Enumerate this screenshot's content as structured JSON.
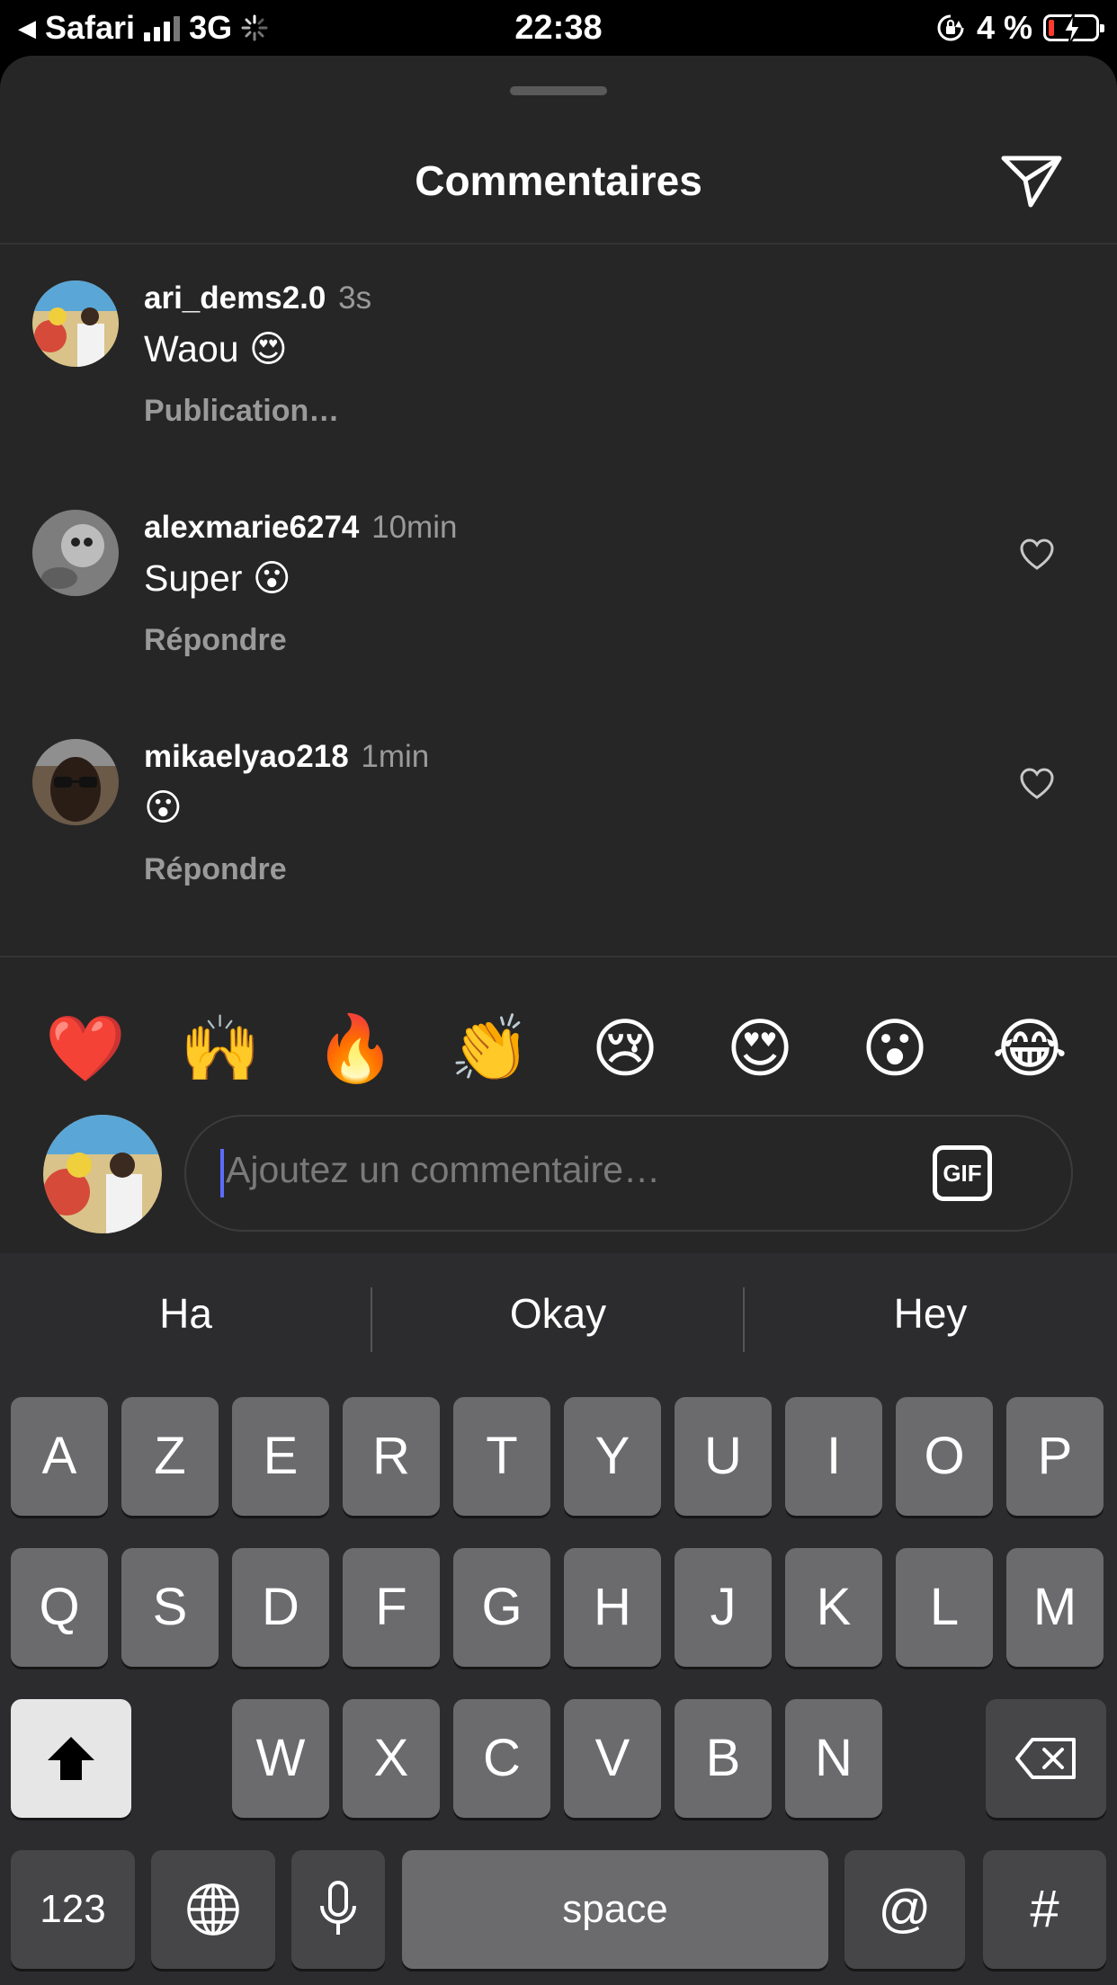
{
  "status_bar": {
    "back_app": "Safari",
    "network": "3G",
    "time": "22:38",
    "battery": "4 %",
    "battery_color": "#ff3b30"
  },
  "sheet": {
    "title": "Commentaires",
    "share_icon": "send-icon"
  },
  "comments": [
    {
      "username": "ari_dems2.0",
      "time": "3s",
      "text": "Waou",
      "emoji": "😍",
      "action": "Publication…"
    },
    {
      "username": "alexmarie6274",
      "time": "10min",
      "text": "Super",
      "emoji": "😮",
      "action": "Répondre"
    },
    {
      "username": "mikaelyao218",
      "time": "1min",
      "text": "",
      "emoji": "😮",
      "action": "Répondre"
    }
  ],
  "quick_reactions": [
    "❤️",
    "🙌",
    "🔥",
    "👏",
    "😢",
    "😍",
    "😮",
    "😂"
  ],
  "composer": {
    "placeholder": "Ajoutez un commentaire…",
    "gif_label": "GIF"
  },
  "keyboard": {
    "suggestions": [
      "Ha",
      "Okay",
      "Hey"
    ],
    "row1": [
      "A",
      "Z",
      "E",
      "R",
      "T",
      "Y",
      "U",
      "I",
      "O",
      "P"
    ],
    "row2": [
      "Q",
      "S",
      "D",
      "F",
      "G",
      "H",
      "J",
      "K",
      "L",
      "M"
    ],
    "row3": [
      "W",
      "X",
      "C",
      "V",
      "B",
      "N"
    ],
    "numbers_label": "123",
    "space_label": "space",
    "at_label": "@",
    "hash_label": "#"
  }
}
